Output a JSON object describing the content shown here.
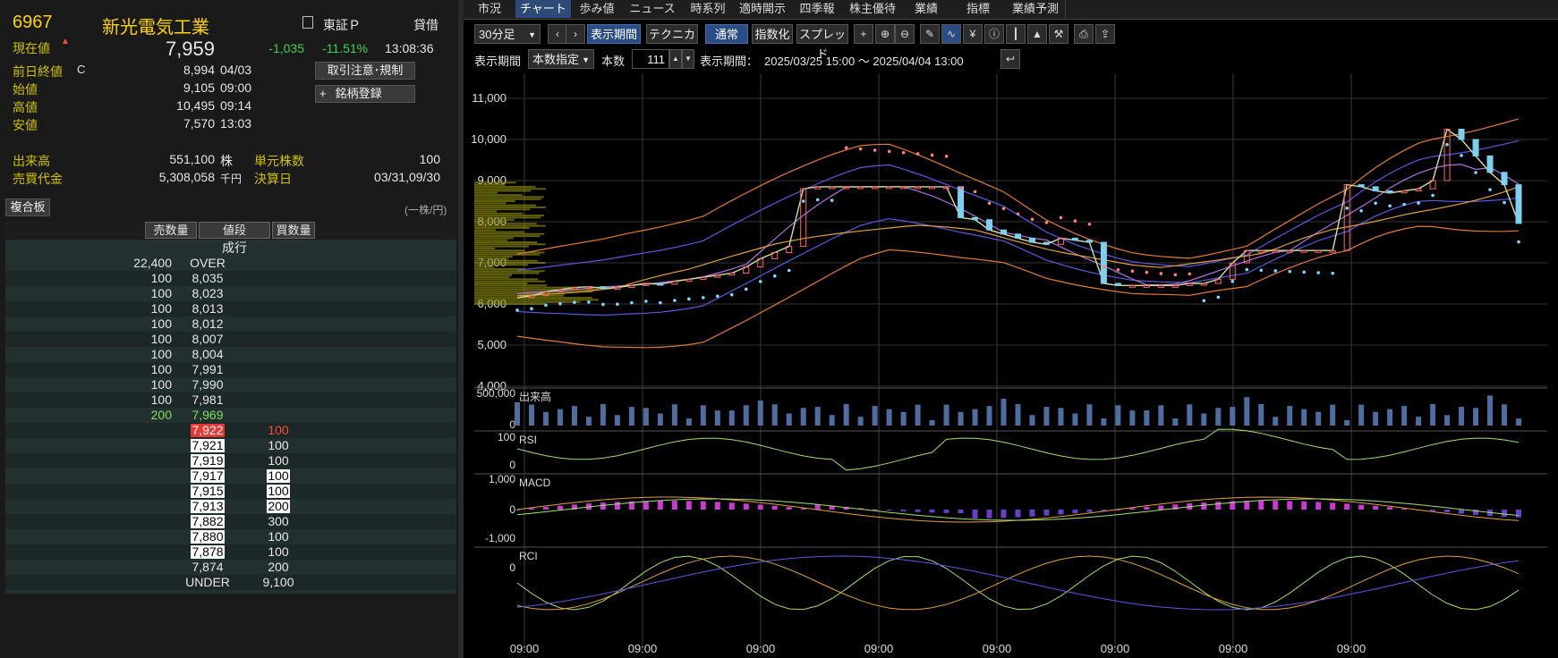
{
  "quote": {
    "code": "6967",
    "name": "新光電気工業",
    "market": "東証Ｐ",
    "margin": "貸借",
    "current_label": "現在値",
    "current": "7,959",
    "change": "-1,035",
    "change_pct": "-11.51%",
    "time": "13:08:36",
    "prev_close_label": "前日終値",
    "prev_close_flag": "C",
    "prev_close": "8,994",
    "prev_close_date": "04/03",
    "open_label": "始値",
    "open": "9,105",
    "open_time": "09:00",
    "high_label": "高値",
    "high": "10,495",
    "high_time": "09:14",
    "low_label": "安値",
    "low": "7,570",
    "low_time": "13:03",
    "volume_label": "出来高",
    "volume": "551,100",
    "volume_unit": "株",
    "turnover_label": "売買代金",
    "turnover": "5,308,058",
    "turnover_unit": "千円",
    "unit_label": "単元株数",
    "unit": "100",
    "settle_label": "決算日",
    "settle": "03/31,09/30",
    "btn_notice": "取引注意･規制",
    "btn_register": "銘柄登録"
  },
  "book": {
    "tab": "複合板",
    "per_share": "(一株/円)",
    "col_sell": "売数量",
    "col_price": "値段",
    "col_buy": "買数量",
    "market_order": "成行",
    "rows": [
      {
        "sell": "22,400",
        "price": "OVER",
        "buy": ""
      },
      {
        "sell": "100",
        "price": "8,035",
        "buy": ""
      },
      {
        "sell": "100",
        "price": "8,023",
        "buy": ""
      },
      {
        "sell": "100",
        "price": "8,013",
        "buy": ""
      },
      {
        "sell": "100",
        "price": "8,012",
        "buy": ""
      },
      {
        "sell": "100",
        "price": "8,007",
        "buy": ""
      },
      {
        "sell": "100",
        "price": "8,004",
        "buy": ""
      },
      {
        "sell": "100",
        "price": "7,991",
        "buy": ""
      },
      {
        "sell": "100",
        "price": "7,990",
        "buy": ""
      },
      {
        "sell": "100",
        "price": "7,981",
        "buy": ""
      },
      {
        "sell": "200",
        "price": "7,969",
        "buy": ""
      },
      {
        "sell": "",
        "price": "7,922",
        "buy": "100"
      },
      {
        "sell": "",
        "price": "7,921",
        "buy": "100"
      },
      {
        "sell": "",
        "price": "7,919",
        "buy": "100"
      },
      {
        "sell": "",
        "price": "7,917",
        "buy": "100"
      },
      {
        "sell": "",
        "price": "7,915",
        "buy": "100"
      },
      {
        "sell": "",
        "price": "7,913",
        "buy": "200"
      },
      {
        "sell": "",
        "price": "7,882",
        "buy": "300"
      },
      {
        "sell": "",
        "price": "7,880",
        "buy": "100"
      },
      {
        "sell": "",
        "price": "7,878",
        "buy": "100"
      },
      {
        "sell": "",
        "price": "7,874",
        "buy": "200"
      },
      {
        "sell": "",
        "price": "UNDER",
        "buy": "9,100"
      }
    ]
  },
  "tabs": [
    "市況",
    "チャート",
    "歩み値",
    "ニュース",
    "時系列",
    "適時開示",
    "四季報",
    "株主優待",
    "業績",
    "指標",
    "業績予測"
  ],
  "toolbar": {
    "interval": "30分足",
    "period_btn": "表示期間",
    "technical": "テクニカル",
    "normal": "通常",
    "index": "指数化",
    "spread": "スプレッド",
    "period_label": "表示期間",
    "period_mode": "本数指定",
    "count_label": "本数",
    "count": "111",
    "range_label": "表示期間：",
    "range": "2025/03/25 15:00 ～ 2025/04/04 13:00"
  },
  "chart_data": {
    "type": "candlestick",
    "price_axis": [
      "11,000",
      "10,000",
      "9,000",
      "8,000",
      "7,000",
      "6,000",
      "5,000",
      "4,000"
    ],
    "x_labels": [
      "09:00",
      "09:00",
      "09:00",
      "09:00",
      "09:00",
      "09:00",
      "09:00",
      "09:00"
    ],
    "panels": [
      {
        "name": "出来高",
        "ticks": [
          "500,000",
          "0"
        ]
      },
      {
        "name": "RSI",
        "ticks": [
          "100",
          "0"
        ]
      },
      {
        "name": "MACD",
        "ticks": [
          "1,000",
          "0",
          "-1,000"
        ]
      },
      {
        "name": "RCI",
        "ticks": [
          "0"
        ]
      }
    ],
    "close_path": [
      6150,
      6200,
      6300,
      6350,
      6400,
      6420,
      6380,
      6400,
      6450,
      6500,
      6480,
      6550,
      6600,
      6650,
      6700,
      6750,
      6900,
      7100,
      7250,
      7400,
      8800,
      8850,
      8850,
      8850,
      8850,
      8850,
      8850,
      8850,
      8850,
      8850,
      8850,
      8100,
      8050,
      7800,
      7700,
      7600,
      7500,
      7450,
      7600,
      7550,
      7500,
      6500,
      6450,
      6450,
      6450,
      6450,
      6450,
      6500,
      6500,
      6600,
      7000,
      7300,
      7300,
      7300,
      7300,
      7300,
      7300,
      7300,
      8900,
      8850,
      8750,
      8700,
      8750,
      8800,
      9000,
      10250,
      10000,
      9600,
      9200,
      8900,
      7959
    ],
    "colors": {
      "up": "#ff6b6b",
      "down": "#7fd0f0",
      "volume": "#4e6ea0",
      "macd_pos": "#c83bd3",
      "macd_neg": "#6a3ec8"
    }
  }
}
